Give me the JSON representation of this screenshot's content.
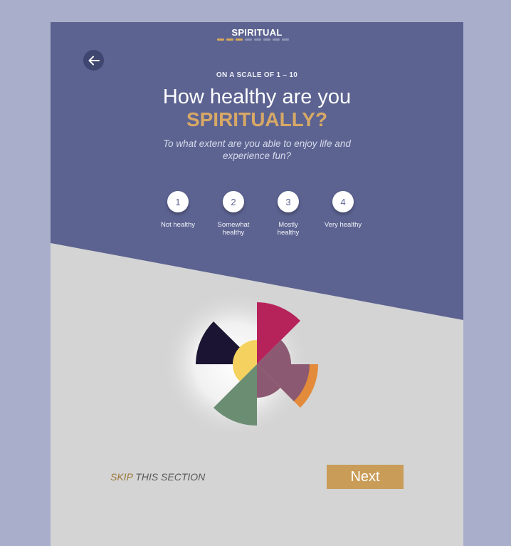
{
  "header": {
    "section_title": "SPIRITUAL",
    "progress_total": 8,
    "progress_done": 3
  },
  "question": {
    "scale_label": "ON A SCALE OF 1 – 10",
    "main": "How healthy are you",
    "accent": "SPIRITUALLY?",
    "description": "To what extent are you able to enjoy life and experience fun?"
  },
  "ratings": [
    {
      "number": "1",
      "label": "Not healthy"
    },
    {
      "number": "2",
      "label": "Somewhat healthy"
    },
    {
      "number": "3",
      "label": "Mostly healthy"
    },
    {
      "number": "4",
      "label": "Very healthy"
    }
  ],
  "footer": {
    "skip_word": "SKIP",
    "skip_rest": " THIS SECTION",
    "next_label": "Next"
  },
  "colors": {
    "panel": "#5c6391",
    "accent": "#d7a866",
    "button": "#c99c57",
    "wheel": [
      "#1b1533",
      "#f5d25f",
      "#b6235b",
      "#8b5a72",
      "#e38b3b",
      "#6b8d72"
    ]
  },
  "icons": {
    "back": "arrow-left-icon"
  }
}
